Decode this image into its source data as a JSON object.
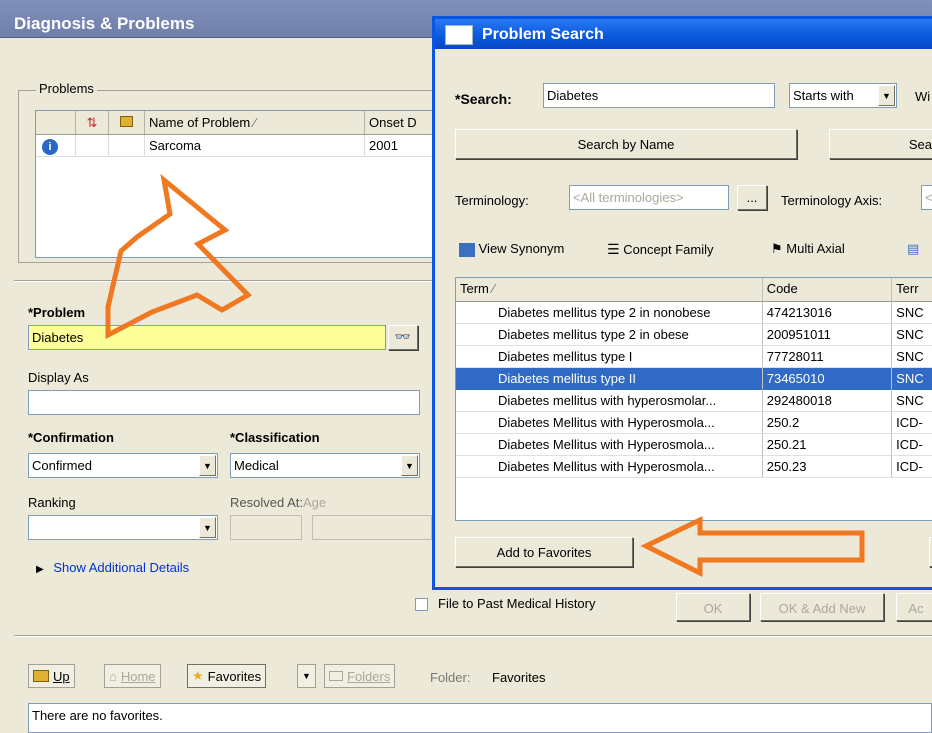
{
  "header": {
    "title": "Diagnosis & Problems"
  },
  "problems_box": {
    "legend": "Problems",
    "columns": [
      "",
      "",
      "",
      "Name of Problem",
      "Onset D"
    ],
    "rows": [
      {
        "name": "Sarcoma",
        "onset": "2001"
      }
    ]
  },
  "form": {
    "problem_label": "*Problem",
    "problem_value": "Diabetes",
    "display_as_label": "Display As",
    "display_as_value": "",
    "confirmation_label": "*Confirmation",
    "confirmation_value": "Confirmed",
    "classification_label": "*Classification",
    "classification_value": "Medical",
    "ranking_label": "Ranking",
    "ranking_value": "",
    "resolved_label": "Resolved At:",
    "resolved_age": "Age",
    "show_details": "Show Additional Details",
    "past_history_label": "File to Past Medical History",
    "ok": "OK",
    "ok_add_new": "OK & Add New",
    "add_partial": "Ac"
  },
  "favorites_bar": {
    "up": "Up",
    "home": "Home",
    "favorites": "Favorites",
    "folders": "Folders",
    "folder_label": "Folder:",
    "folder_value": "Favorites",
    "empty_message": "There are no favorites."
  },
  "dialog": {
    "title": "Problem Search",
    "search_label": "*Search:",
    "search_value": "Diabetes",
    "match_mode": "Starts with",
    "partial_wi": "Wi",
    "search_by_name": "Search by Name",
    "search_partial": "Sea",
    "terminology_label": "Terminology:",
    "terminology_value": "<All terminologies>",
    "ellipsis": "...",
    "axis_label": "Terminology Axis:",
    "axis_value_partial": "<",
    "view_synonym": "View Synonym",
    "concept_family": "Concept Family",
    "multi_axial": "Multi Axial",
    "columns": {
      "term": "Term",
      "code": "Code",
      "term_partial": "Terr"
    },
    "results": [
      {
        "term": "Diabetes mellitus type 2 in nonobese",
        "code": "474213016",
        "sys": "SNC"
      },
      {
        "term": "Diabetes mellitus type 2 in obese",
        "code": "200951011",
        "sys": "SNC"
      },
      {
        "term": "Diabetes mellitus type I",
        "code": "77728011",
        "sys": "SNC"
      },
      {
        "term": "Diabetes mellitus type II",
        "code": "73465010",
        "sys": "SNC"
      },
      {
        "term": "Diabetes mellitus with hyperosmolar...",
        "code": "292480018",
        "sys": "SNC"
      },
      {
        "term": "Diabetes Mellitus with Hyperosmola...",
        "code": "250.2",
        "sys": "ICD-"
      },
      {
        "term": "Diabetes Mellitus with Hyperosmola...",
        "code": "250.21",
        "sys": "ICD-"
      },
      {
        "term": "Diabetes Mellitus with Hyperosmola...",
        "code": "250.23",
        "sys": "ICD-"
      }
    ],
    "selected_index": 3,
    "add_to_favorites": "Add to Favorites"
  },
  "colors": {
    "header_bg": "#7282ae",
    "dialog_title": "#0a57dc",
    "selection": "#316ac5",
    "highlight_field": "#ffff99",
    "annotation_arrow": "#f07820",
    "link": "#0033cc"
  }
}
